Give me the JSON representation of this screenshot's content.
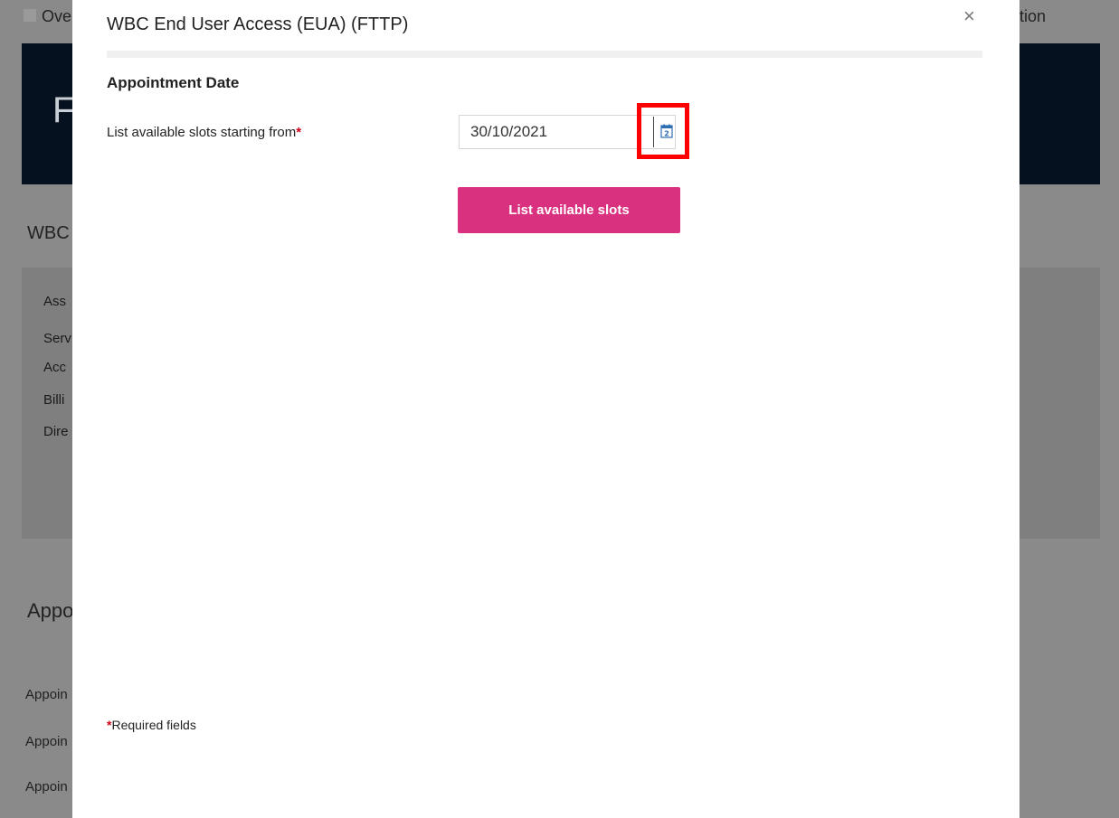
{
  "background": {
    "nav_left": "Ove",
    "nav_right": "tion",
    "hero_text": "F",
    "section_title": "WBC",
    "panel_items": [
      "Ass",
      "Serv",
      "Acc",
      "Billi",
      "Dire"
    ],
    "appointments_title": "Appoi",
    "appointment_items": [
      "Appoin",
      "Appoin",
      "Appoin"
    ]
  },
  "modal": {
    "title": "WBC End User Access (EUA) (FTTP)",
    "close_label": "×",
    "section_heading": "Appointment Date",
    "field_label": "List available slots starting from",
    "required_marker": "*",
    "date_value": "30/10/2021",
    "calendar_icon": "calendar-icon",
    "calendar_day": "2",
    "list_button": "List available slots",
    "required_note": "Required fields"
  },
  "colors": {
    "accent": "#d9307f",
    "required": "#d0021b",
    "highlight": "#ff0000",
    "overlay": "#8a8a8a"
  }
}
